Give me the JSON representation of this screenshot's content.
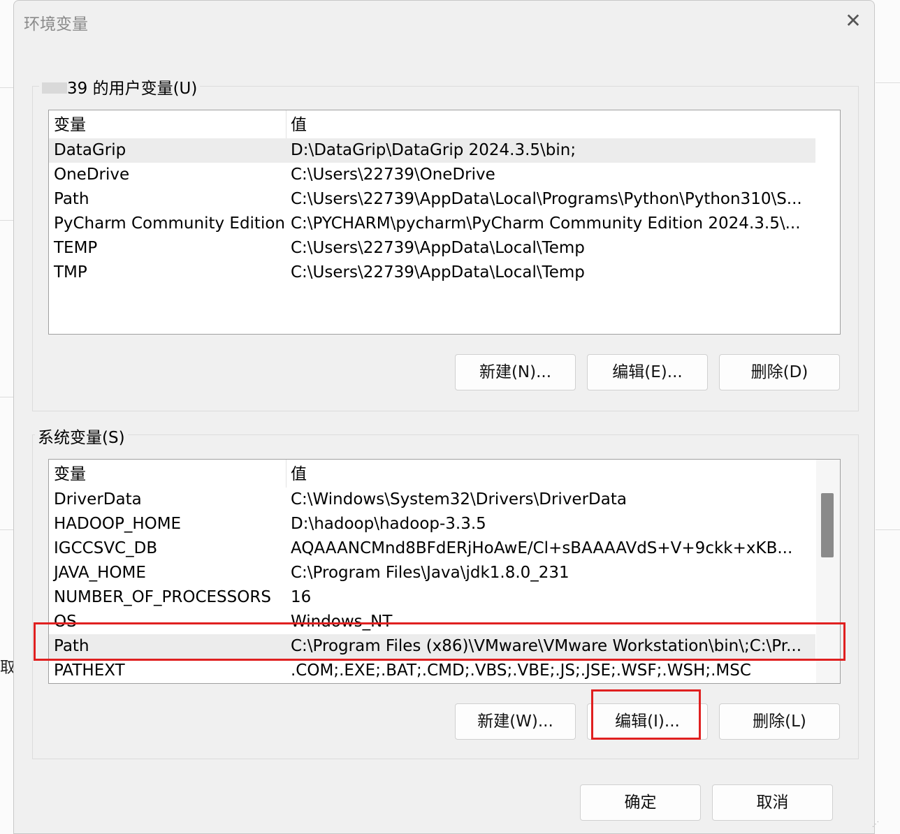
{
  "dialog": {
    "title": "环境变量",
    "close_glyph": "✕"
  },
  "background": {
    "edge_char": "取"
  },
  "user_vars": {
    "label_suffix": "39 的用户变量(U)",
    "headers": {
      "name": "变量",
      "value": "值"
    },
    "rows": [
      {
        "name": "DataGrip",
        "value": "D:\\DataGrip\\DataGrip 2024.3.5\\bin;"
      },
      {
        "name": "OneDrive",
        "value": "C:\\Users\\22739\\OneDrive"
      },
      {
        "name": "Path",
        "value": "C:\\Users\\22739\\AppData\\Local\\Programs\\Python\\Python310\\S..."
      },
      {
        "name": "PyCharm Community Edition",
        "value": "C:\\PYCHARM\\pycharm\\PyCharm Community Edition 2024.3.5\\..."
      },
      {
        "name": "TEMP",
        "value": "C:\\Users\\22739\\AppData\\Local\\Temp"
      },
      {
        "name": "TMP",
        "value": "C:\\Users\\22739\\AppData\\Local\\Temp"
      }
    ],
    "buttons": {
      "new": "新建(N)...",
      "edit": "编辑(E)...",
      "delete": "删除(D)"
    }
  },
  "system_vars": {
    "label": "系统变量(S)",
    "headers": {
      "name": "变量",
      "value": "值"
    },
    "rows": [
      {
        "name": "DriverData",
        "value": "C:\\Windows\\System32\\Drivers\\DriverData"
      },
      {
        "name": "HADOOP_HOME",
        "value": "D:\\hadoop\\hadoop-3.3.5"
      },
      {
        "name": "IGCCSVC_DB",
        "value": "AQAAANCMnd8BFdERjHoAwE/Cl+sBAAAAVdS+V+9ckk+xKB..."
      },
      {
        "name": "JAVA_HOME",
        "value": "C:\\Program Files\\Java\\jdk1.8.0_231"
      },
      {
        "name": "NUMBER_OF_PROCESSORS",
        "value": "16"
      },
      {
        "name": "OS",
        "value": "Windows_NT"
      },
      {
        "name": "Path",
        "value": "C:\\Program Files (x86)\\VMware\\VMware Workstation\\bin\\;C:\\Pr..."
      },
      {
        "name": "PATHEXT",
        "value": ".COM;.EXE;.BAT;.CMD;.VBS;.VBE;.JS;.JSE;.WSF;.WSH;.MSC"
      }
    ],
    "buttons": {
      "new": "新建(W)...",
      "edit": "编辑(I)...",
      "delete": "删除(L)"
    }
  },
  "footer": {
    "ok": "确定",
    "cancel": "取消"
  },
  "colors": {
    "highlight": "#e02020",
    "selected_row": "#ececec"
  }
}
